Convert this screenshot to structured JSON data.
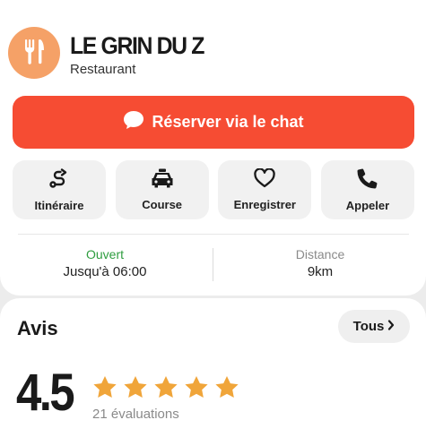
{
  "place": {
    "name": "LE GRIN DU Z",
    "category": "Restaurant",
    "logo_icon": "fork-knife-icon"
  },
  "cta": {
    "label": "Réserver via le chat",
    "icon": "chat-bubble-icon",
    "color": "#f64c33"
  },
  "actions": [
    {
      "label": "Itinéraire",
      "icon": "route-icon"
    },
    {
      "label": "Course",
      "icon": "car-icon"
    },
    {
      "label": "Enregistrer",
      "icon": "heart-icon"
    },
    {
      "label": "Appeler",
      "icon": "phone-icon"
    }
  ],
  "info": {
    "status": "Ouvert",
    "hours": "Jusqu'à 06:00",
    "distance_label": "Distance",
    "distance_value": "9km",
    "status_color": "#2e9d3f"
  },
  "reviews": {
    "title": "Avis",
    "all_label": "Tous",
    "rating": "4.5",
    "stars": 5,
    "count_label": "21 évaluations",
    "star_color": "#f0a53a"
  }
}
